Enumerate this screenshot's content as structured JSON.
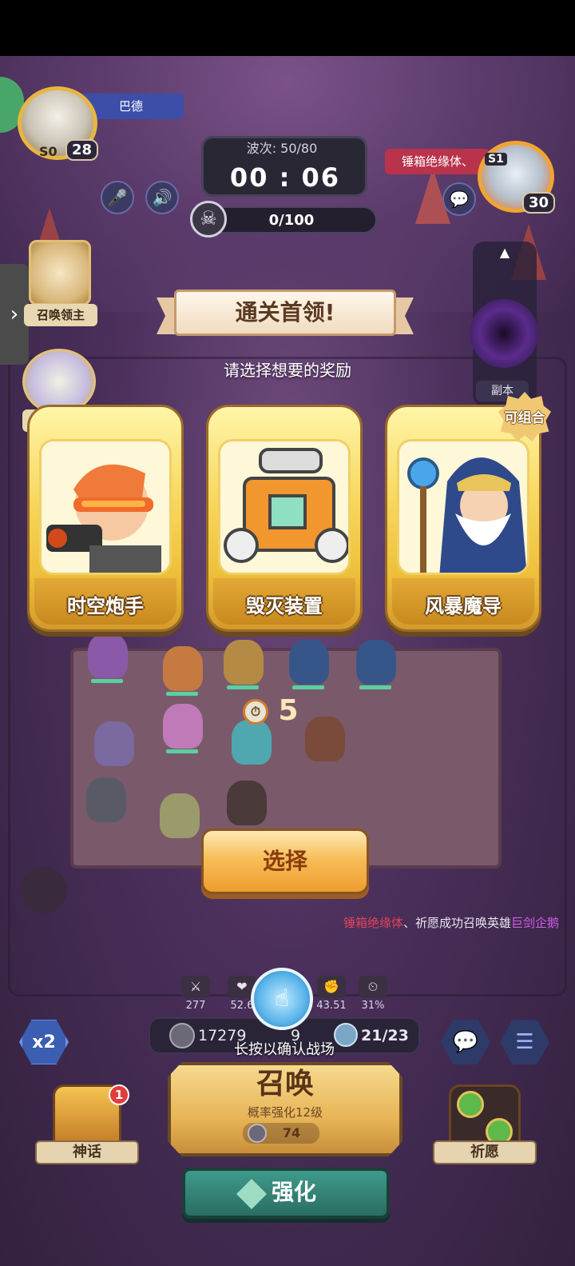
{
  "hud": {
    "player_name": "巴德",
    "player_level": "28",
    "player_tag": "S0",
    "wave_label": "波次: 50/80",
    "timer": "00 : 06",
    "kill_progress": "0/100",
    "enemy_name": "锤箱绝缘体、",
    "enemy_level": "30",
    "enemy_tag": "S1",
    "summoner_label": "召唤领主",
    "summoner2_label": "召唤",
    "dungeon_label": "副本"
  },
  "reward": {
    "banner_title": "通关首领!",
    "subtitle": "请选择想要的奖励",
    "combo_badge": "可组合",
    "cards": [
      {
        "name": "时空炮手"
      },
      {
        "name": "毁灭装置"
      },
      {
        "name": "风暴魔导"
      }
    ],
    "select_label": "选择",
    "countdown": "5"
  },
  "message": {
    "prefix": "锤箱绝缘体",
    "middle": "、祈愿成功召唤英雄",
    "hero": "巨剑企鹅",
    "colors": {
      "name": "#e0445a",
      "text": "#e9e3f0",
      "hero": "#d15ee8"
    }
  },
  "stats": [
    {
      "icon": "attack-icon",
      "value": "277"
    },
    {
      "icon": "crit-icon",
      "value": "52.6"
    },
    {
      "icon": "power-icon",
      "value": "43.51"
    },
    {
      "icon": "speed-stat-icon",
      "value": "31%"
    }
  ],
  "resources": {
    "coins": "17279",
    "gems": "9",
    "population": "21/23"
  },
  "hint": "长按以确认战场",
  "controls": {
    "speed": "x2",
    "myth_label": "神话",
    "myth_badge": "1",
    "wish_label": "祈愿",
    "summon_title": "召唤",
    "summon_sub": "概率强化12级",
    "summon_cost": "74",
    "upgrade_label": "强化"
  }
}
